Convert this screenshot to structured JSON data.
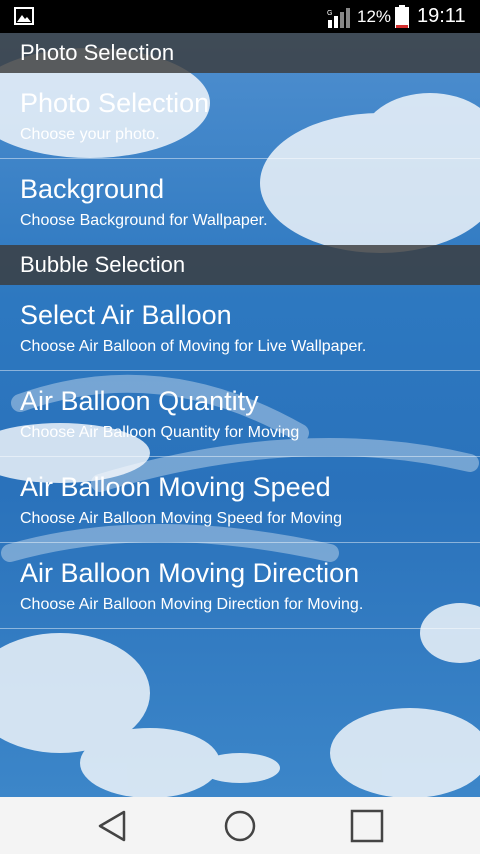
{
  "status_bar": {
    "battery_percent": "12%",
    "time": "19:11",
    "icons": [
      "gallery-icon",
      "signal-icon",
      "battery-icon"
    ]
  },
  "sections": [
    {
      "header": "Photo Selection",
      "items": [
        {
          "title": "Photo Selection",
          "summary": "Choose your photo."
        },
        {
          "title": "Background",
          "summary": "Choose Background for Wallpaper."
        }
      ]
    },
    {
      "header": "Bubble Selection",
      "items": [
        {
          "title": "Select Air Balloon",
          "summary": "Choose  Air Balloon of Moving for Live Wallpaper."
        },
        {
          "title": "Air Balloon Quantity",
          "summary": "Choose Air Balloon Quantity for Moving"
        },
        {
          "title": "Air Balloon Moving Speed",
          "summary": "Choose Air Balloon Moving Speed for Moving"
        },
        {
          "title": "Air Balloon Moving Direction",
          "summary": "Choose Air Balloon Moving Direction for Moving."
        }
      ]
    }
  ],
  "nav_bar": {
    "icons": [
      "back-icon",
      "home-icon",
      "recents-icon"
    ]
  },
  "colors": {
    "header_bg": "#3c3c3c",
    "sky": "#2f7cc0",
    "status_bg": "#000000",
    "nav_bg": "#f4f4f4"
  }
}
